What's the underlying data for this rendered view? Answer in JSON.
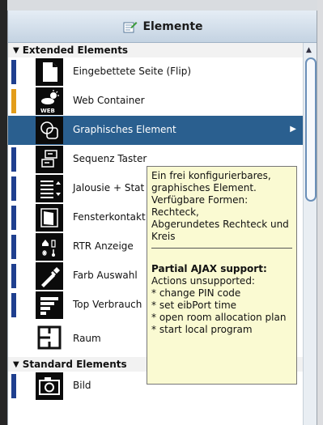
{
  "panel": {
    "title": "Elemente",
    "title_icon": "edit-page-icon"
  },
  "groups": [
    {
      "label": "Extended Elements",
      "items": [
        {
          "label": "Eingebettete Seite (Flip)",
          "icon": "page-icon",
          "accent": "#1f3f8f"
        },
        {
          "label": "Web Container",
          "icon": "web-weather-icon",
          "accent": "#e39d1a"
        },
        {
          "label": "Graphisches Element",
          "icon": "shapes-icon",
          "accent": "#1f3f8f",
          "selected": true
        },
        {
          "label": "Sequenz Taster",
          "icon": "sequence-icon",
          "accent": "#1f3f8f"
        },
        {
          "label": "Jalousie + Stat",
          "icon": "blind-icon",
          "accent": "#1f3f8f"
        },
        {
          "label": "Fensterkontakt",
          "icon": "window-icon",
          "accent": "#1f3f8f"
        },
        {
          "label": "RTR Anzeige",
          "icon": "thermostat-icon",
          "accent": "#1f3f8f"
        },
        {
          "label": "Farb Auswahl",
          "icon": "pipette-icon",
          "accent": "#1f3f8f"
        },
        {
          "label": "Top Verbrauch",
          "icon": "bar-list-icon",
          "accent": "#1f3f8f"
        },
        {
          "label": "Raum",
          "icon": "room-plan-icon",
          "accent": null
        }
      ]
    },
    {
      "label": "Standard Elements",
      "items": [
        {
          "label": "Bild",
          "icon": "camera-icon",
          "accent": "#1f3f8f"
        }
      ]
    }
  ],
  "tooltip": {
    "description": "Ein frei konfigurierbares,\ngraphisches Element.\nVerfügbare Formen:\nRechteck,\nAbgerundetes Rechteck und\nKreis",
    "ajax": "Partial AJAX support:",
    "actions_title": "Actions unsupported:",
    "actions": [
      "* change PIN code",
      "* set eibPort time",
      "* open room allocation plan",
      "* start local program"
    ]
  }
}
